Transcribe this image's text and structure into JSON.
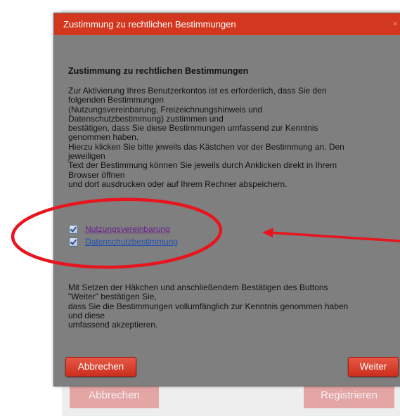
{
  "background": {
    "cancel_label": "Abbrechen",
    "register_label": "Registrieren"
  },
  "dialog": {
    "title": "Zustimmung zu rechtlichen Bestimmungen",
    "close_glyph": "×",
    "heading": "Zustimmung zu rechtlichen Bestimmungen",
    "paragraph1_lines": [
      "Zur Aktivierung Ihres Benutzerkontos ist es erforderlich, dass Sie den",
      "folgenden Bestimmungen",
      "(Nutzungsvereinbarung, Freizeichnungshinweis und",
      "Datenschutzbestimmung) zustimmen und",
      "bestätigen, dass Sie diese Bestimmungen umfassend zur Kenntnis",
      "genommen haben.",
      "Hierzu klicken Sie bitte jeweils das Kästchen vor der Bestimmung an. Den",
      "jeweiligen",
      "Text der Bestimmung können Sie jeweils durch Anklicken direkt in Ihrem",
      "Browser öffnen",
      "und dort ausdrucken oder auf Ihrem Rechner abspeichern."
    ],
    "checks": [
      {
        "label": "Nutzungsvereinbarung",
        "checked": true
      },
      {
        "label": "Datenschutzbestimmung",
        "checked": true
      }
    ],
    "paragraph2_lines": [
      "Mit Setzen der Häkchen und anschließendem Bestätigen des Buttons",
      "\"Weiter\" bestätigen Sie,",
      "dass Sie die Bestimmungen vollumfänglich zur Kenntnis genommen haben",
      "und diese",
      "umfassend akzeptieren."
    ],
    "cancel_label": "Abbrechen",
    "next_label": "Weiter"
  },
  "colors": {
    "titlebar": "#d4371f",
    "dialog_bg": "#7f7f7f",
    "annotation": "#e8141e"
  }
}
